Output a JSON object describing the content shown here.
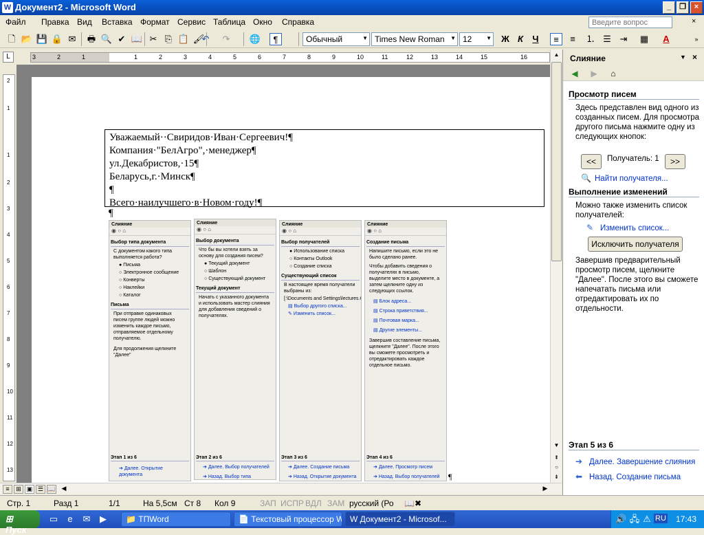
{
  "window": {
    "title": "Документ2 - Microsoft Word",
    "app_icon": "W"
  },
  "menu": {
    "items": [
      "Файл",
      "Правка",
      "Вид",
      "Вставка",
      "Формат",
      "Сервис",
      "Таблица",
      "Окно",
      "Справка"
    ],
    "ask_placeholder": "Введите вопрос",
    "close_glyph": "×"
  },
  "toolbar": {
    "style": "Обычный",
    "font": "Times New Roman",
    "size": "12",
    "bold": "Ж",
    "italic": "К",
    "underline": "Ч",
    "font_color_letter": "A",
    "pilcrow": "¶"
  },
  "ruler": {
    "numbers": [
      "3",
      "2",
      "1",
      "1",
      "2",
      "3",
      "4",
      "5",
      "6",
      "7",
      "8",
      "9",
      "10",
      "11",
      "12",
      "13",
      "14",
      "15",
      "16"
    ],
    "tab_glyph": "L"
  },
  "vruler": {
    "numbers": [
      "2",
      "1",
      "1",
      "2",
      "3",
      "4",
      "5",
      "6",
      "7",
      "8",
      "9",
      "10",
      "11",
      "12",
      "13"
    ]
  },
  "document": {
    "address_lines": [
      "Уважаемый··Свиридов·Иван·Сергеевич!¶",
      "Компания·\"БелАгро\",·менеджер¶",
      "ул.Декабристов,·15¶",
      "Беларусь,г.·Минск¶",
      "¶",
      "Всего·наилучшего·в·Новом·году!¶"
    ],
    "pilcrow": "¶"
  },
  "embedded_panes": [
    {
      "title": "Слияние",
      "heading": "Выбор типа документа",
      "text": "С документом какого типа выполняется работа?",
      "options": [
        "Письма",
        "Электронное сообщение",
        "Конверты",
        "Наклейки",
        "Каталог"
      ],
      "heading2": "Письма",
      "text2": "При отправке одинаковых писем группе людей можно изменить каждое письмо, отправляемое отдельному получателю.",
      "text3": "Для продолжения щелкните \"Далее\"",
      "links": [],
      "step": "Этап 1 из 6",
      "next": "Далее. Открытие документа",
      "back": ""
    },
    {
      "title": "Слияние",
      "heading": "Выбор документа",
      "text": "Что бы вы хотели взять за основу для создания писем?",
      "options": [
        "Текущий документ",
        "Шаблон",
        "Существующий документ"
      ],
      "heading2": "Текущий документ",
      "text2": "Начать с указанного документа и использовать мастер слияния для добавления сведений о получателях.",
      "text3": "",
      "links": [],
      "step": "Этап 2 из 6",
      "next": "Далее. Выбор получателей",
      "back": "Назад. Выбор типа документа"
    },
    {
      "title": "Слияние",
      "heading": "Выбор получателей",
      "text": "",
      "options": [
        "Использование списка",
        "Контакты Outlook",
        "Создание списка"
      ],
      "heading2": "Существующий список",
      "text2": "В настоящее время получатели выбраны из:",
      "text3": "[:\\Documents and Settings\\lectures.CL",
      "links": [
        "Выбор другого списка...",
        "Изменить список..."
      ],
      "step": "Этап 3 из 6",
      "next": "Далее. Создание письма",
      "back": "Назад. Открытие документа"
    },
    {
      "title": "Слияние",
      "heading": "Создание письма",
      "text": "Напишите письмо, если это не было сделано ранее.",
      "options": [],
      "heading2": "",
      "text2": "Чтобы добавить сведения о получателях в письмо, выделите место в документе, а затем щелкните одну из следующих ссылок.",
      "text3": "Завершив составление письма, щелкните \"Далее\". После этого вы сможете просмотреть и отредактировать каждое отдельное письмо.",
      "links": [
        "Блок адреса...",
        "Строка приветствия...",
        "Почтовая марка...",
        "Другие элементы..."
      ],
      "step": "Этап 4 из 6",
      "next": "Далее. Просмотр писем",
      "back": "Назад. Выбор получателей"
    }
  ],
  "taskpane": {
    "title": "Слияние",
    "section1": "Просмотр писем",
    "text1": "Здесь представлен вид одного из созданных писем. Для просмотра другого письма нажмите одну из следующих кнопок:",
    "prev_btn": "<<",
    "recipient_label": "Получатель: 1",
    "next_btn": ">>",
    "find_link": "Найти получателя...",
    "section2": "Выполнение изменений",
    "text2": "Можно также изменить список получателей:",
    "edit_link": "Изменить список...",
    "exclude_btn": "Исключить получателя",
    "text3": "Завершив предварительный просмотр писем, щелкните \"Далее\". После этого вы сможете напечатать письма или отредактировать их по отдельности.",
    "step": "Этап 5 из 6",
    "next_link": "Далее. Завершение слияния",
    "back_link": "Назад. Создание письма"
  },
  "status": {
    "page": "Стр. 1",
    "section": "Разд 1",
    "pages": "1/1",
    "at": "На 5,5см",
    "line": "Ст 8",
    "col": "Кол 9",
    "rec": "ЗАП",
    "trk": "ИСПР",
    "ext": "ВДЛ",
    "ovr": "ЗАМ",
    "lang": "русский (Ро"
  },
  "taskbar": {
    "start": "Пуск",
    "tasks": [
      "ТПWord",
      "Текстовый процессор W...",
      "Документ2 - Microsof..."
    ],
    "lang": "RU",
    "clock": "17:43"
  }
}
